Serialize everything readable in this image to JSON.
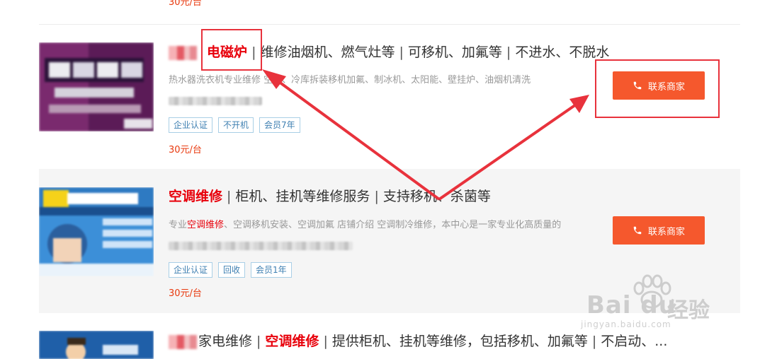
{
  "top_price": "30元/台",
  "listings": [
    {
      "title_brand": "电磁炉",
      "title_rest": [
        "维修油烟机、燃气灶等",
        "可移机、加氟等",
        "不进水、不脱水"
      ],
      "desc": "热水器洗衣机专业维修 空调、冷库拆装移机加氟、制冰机、太阳能、壁挂炉、油烟机清洗",
      "tags": [
        "企业认证",
        "不开机",
        "会员7年"
      ],
      "price": "30元/台",
      "button_label": "联系商家"
    },
    {
      "title_brand": "空调维修",
      "title_rest": [
        "柜机、挂机等维修服务",
        "支持移机、杀菌等"
      ],
      "desc_prefix": "专业",
      "desc_keyword": "空调维修",
      "desc_suffix": "、空调移机安装、空调加氟 店铺介绍 空调制冷维修，本中心是一家专业化高质量的\u0000",
      "tags": [
        "企业认证",
        "回收",
        "会员1年"
      ],
      "price": "30元/台",
      "button_label": "联系商家"
    },
    {
      "title_lead": "家电维修",
      "title_brand": "空调维修",
      "title_rest": [
        "提供柜机、挂机等维修，包括移机、加氟等",
        "不启动、..."
      ]
    }
  ],
  "watermark": {
    "brand": "Bai du",
    "cn": "经验",
    "url": "jingyan.baidu.com"
  },
  "colors": {
    "accent": "#f5582d",
    "keyword_red": "#e8000b",
    "tag_blue": "#3e7fb1",
    "annotation": "#e8323c"
  }
}
